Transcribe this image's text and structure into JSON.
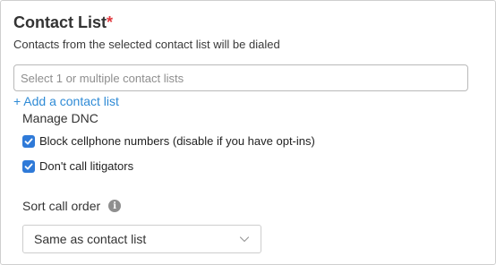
{
  "contact_list": {
    "title": "Contact List",
    "required_marker": "*",
    "subtitle": "Contacts from the selected contact list will be dialed",
    "input_placeholder": "Select 1 or multiple contact lists",
    "add_link": "+ Add a contact list"
  },
  "dnc": {
    "heading": "Manage DNC",
    "options": [
      {
        "label": "Block cellphone numbers (disable if you have opt-ins)",
        "checked": true
      },
      {
        "label": "Don't call litigators",
        "checked": true
      }
    ]
  },
  "sort": {
    "label": "Sort call order",
    "info_icon": "i",
    "selected": "Same as contact list"
  },
  "colors": {
    "accent": "#2f7ad8",
    "link": "#2f8bd6",
    "required": "#e0383e"
  }
}
